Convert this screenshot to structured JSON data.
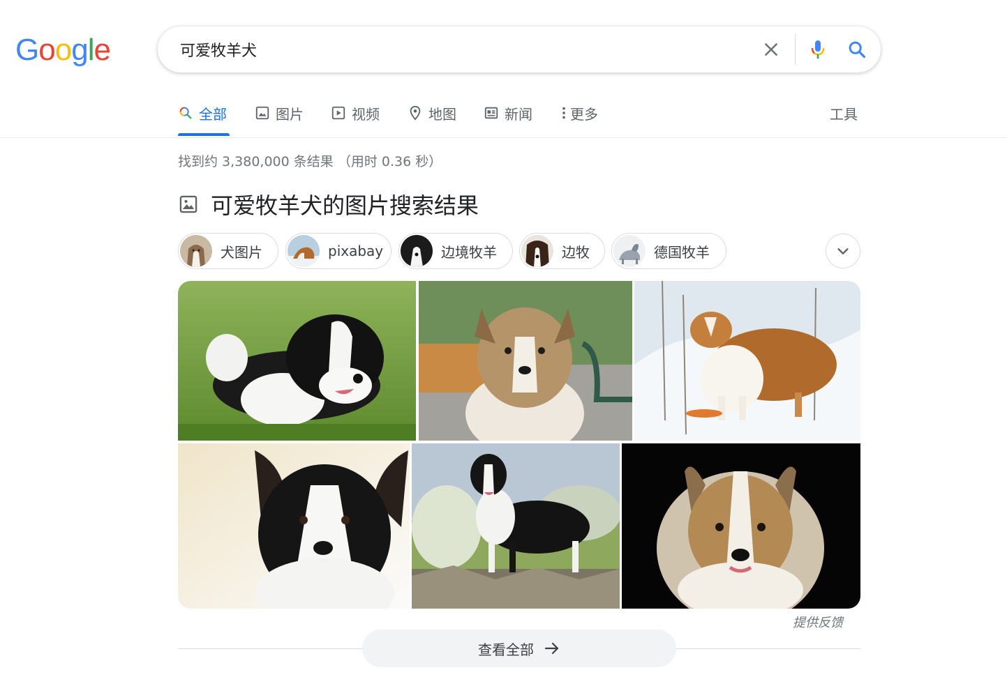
{
  "logo": {
    "letters": [
      "G",
      "o",
      "o",
      "g",
      "l",
      "e"
    ]
  },
  "search": {
    "query": "可爱牧羊犬"
  },
  "tabs": [
    {
      "label": "全部",
      "icon": "search-icon"
    },
    {
      "label": "图片",
      "icon": "image-icon"
    },
    {
      "label": "视频",
      "icon": "video-icon"
    },
    {
      "label": "地图",
      "icon": "map-pin-icon"
    },
    {
      "label": "新闻",
      "icon": "news-icon"
    },
    {
      "label": "更多",
      "icon": "more-vert-icon"
    }
  ],
  "tools_label": "工具",
  "result_stats": "找到约 3,380,000 条结果 （用时 0.36 秒）",
  "images_section": {
    "title": "可爱牧羊犬的图片搜索结果",
    "chips": [
      {
        "label": "犬图片"
      },
      {
        "label": "pixabay"
      },
      {
        "label": "边境牧羊"
      },
      {
        "label": "边牧"
      },
      {
        "label": "德国牧羊"
      }
    ],
    "feedback_label": "提供反馈",
    "view_all_label": "查看全部"
  },
  "colors": {
    "google_blue": "#4285f4",
    "google_red": "#ea4335",
    "google_yellow": "#fbbc05",
    "google_green": "#34a853",
    "tab_active": "#1a73e8"
  }
}
